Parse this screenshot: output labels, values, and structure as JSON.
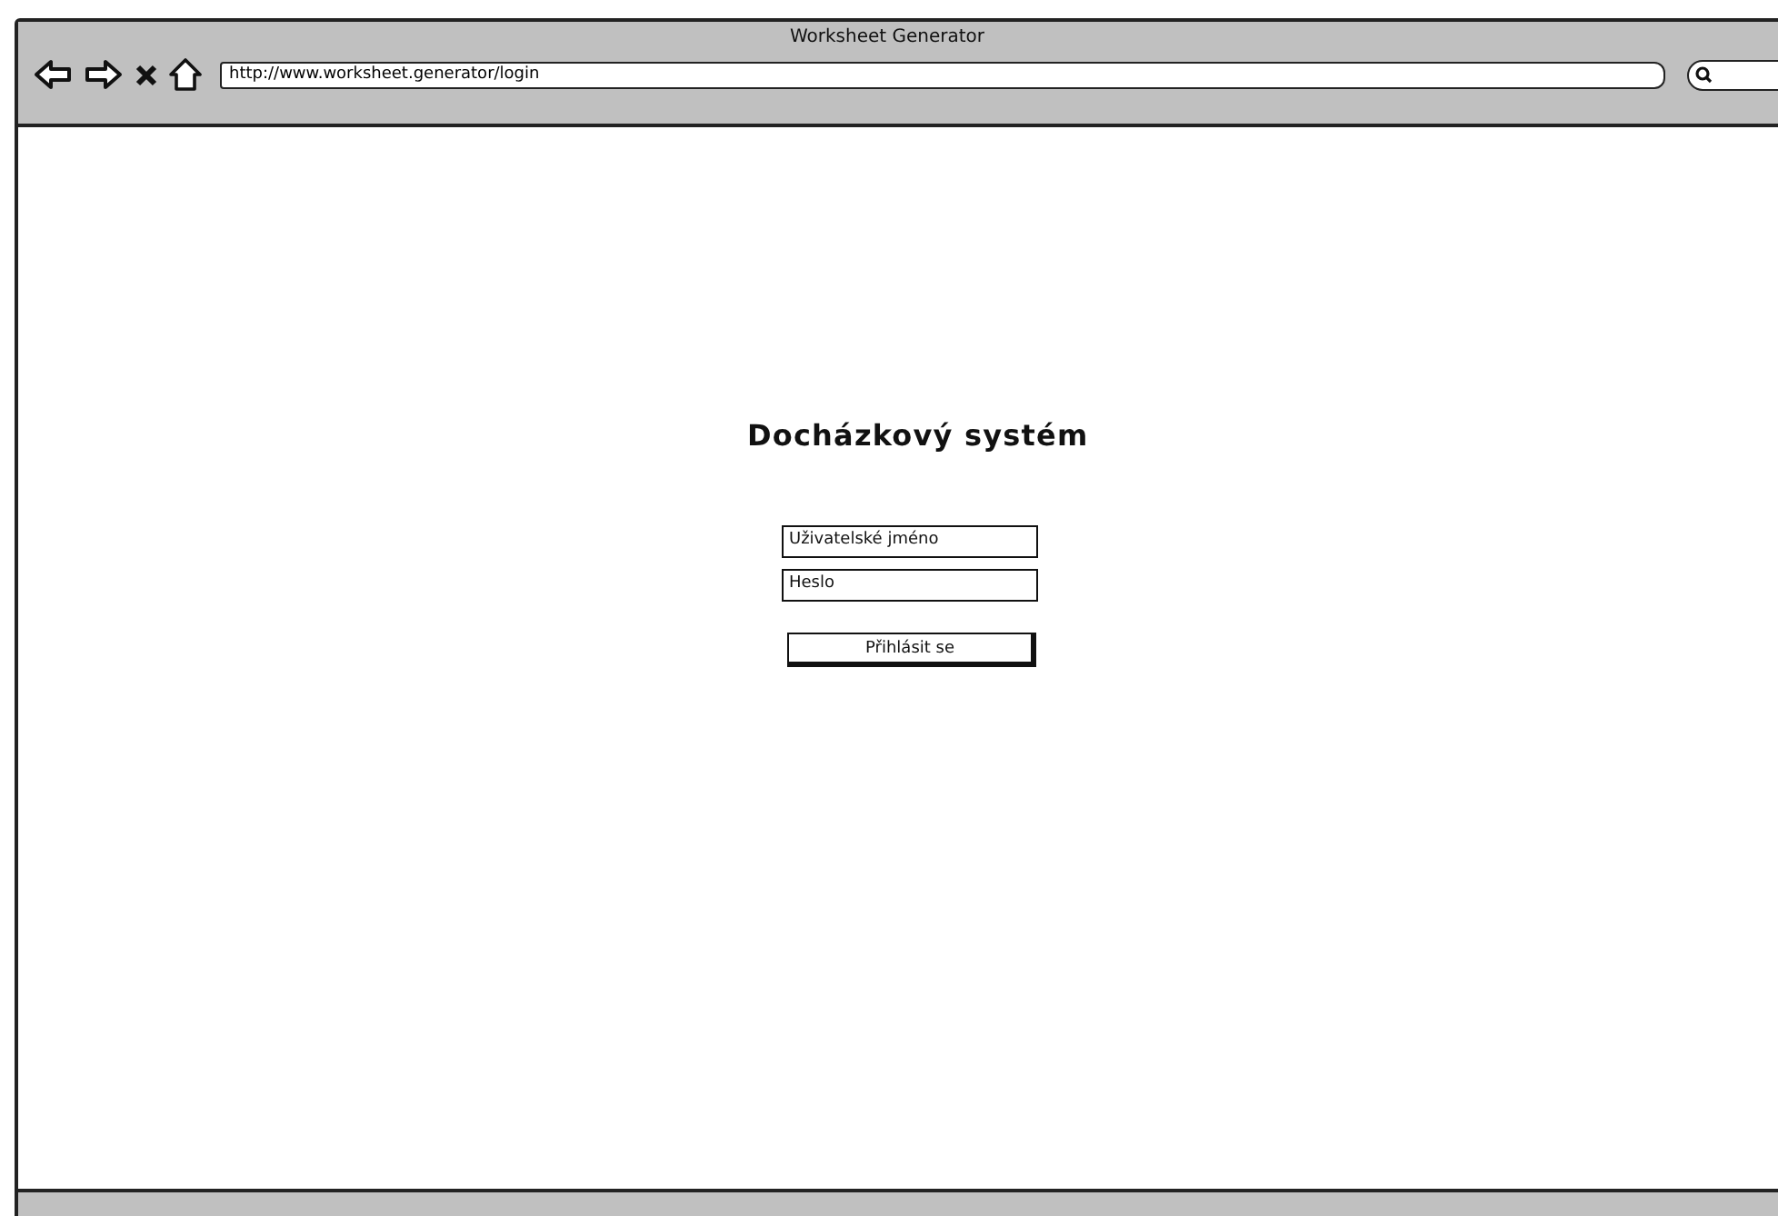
{
  "window": {
    "title": "Worksheet Generator"
  },
  "toolbar": {
    "address": "http://www.worksheet.generator/login"
  },
  "login": {
    "title": "Docházkový systém",
    "fields": [
      {
        "value": "Uživatelské jméno"
      },
      {
        "value": "Heslo"
      }
    ],
    "button": "Přihlásit se"
  }
}
